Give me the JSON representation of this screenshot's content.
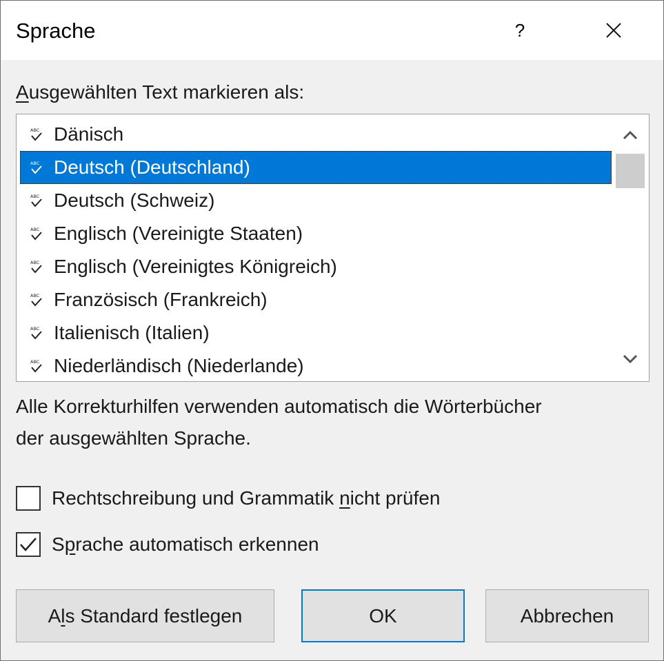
{
  "dialog": {
    "title": "Sprache",
    "help_label": "?",
    "close_icon": "close-icon"
  },
  "language_list": {
    "label_accel": "A",
    "label_rest": "usgewählten Text markieren als:",
    "items": [
      {
        "label": "Dänisch",
        "icon": "spellcheck-icon",
        "selected": false
      },
      {
        "label": "Deutsch (Deutschland)",
        "icon": "spellcheck-icon",
        "selected": true
      },
      {
        "label": "Deutsch (Schweiz)",
        "icon": "spellcheck-icon",
        "selected": false
      },
      {
        "label": "Englisch (Vereinigte Staaten)",
        "icon": "spellcheck-icon",
        "selected": false
      },
      {
        "label": "Englisch (Vereinigtes Königreich)",
        "icon": "spellcheck-icon",
        "selected": false
      },
      {
        "label": "Französisch (Frankreich)",
        "icon": "spellcheck-icon",
        "selected": false
      },
      {
        "label": "Italienisch (Italien)",
        "icon": "spellcheck-icon",
        "selected": false
      },
      {
        "label": "Niederländisch (Niederlande)",
        "icon": "spellcheck-icon",
        "selected": false
      }
    ]
  },
  "info": {
    "line1": "Alle Korrekturhilfen verwenden automatisch die Wörterbücher",
    "line2": "der ausgewählten Sprache."
  },
  "options": {
    "no_proofing": {
      "label_pre": "Rechtschreibung und Grammatik ",
      "label_accel": "n",
      "label_post": "icht prüfen",
      "checked": false
    },
    "detect_language": {
      "label_pre": "S",
      "label_accel": "p",
      "label_post": "rache automatisch erkennen",
      "checked": true
    }
  },
  "buttons": {
    "set_default": {
      "pre": "A",
      "accel": "l",
      "post": "s Standard festlegen"
    },
    "ok": "OK",
    "cancel": "Abbrechen"
  },
  "colors": {
    "selection": "#0078d7",
    "dialog_bg": "#f0f0f0",
    "default_button_border": "#0078d7"
  }
}
